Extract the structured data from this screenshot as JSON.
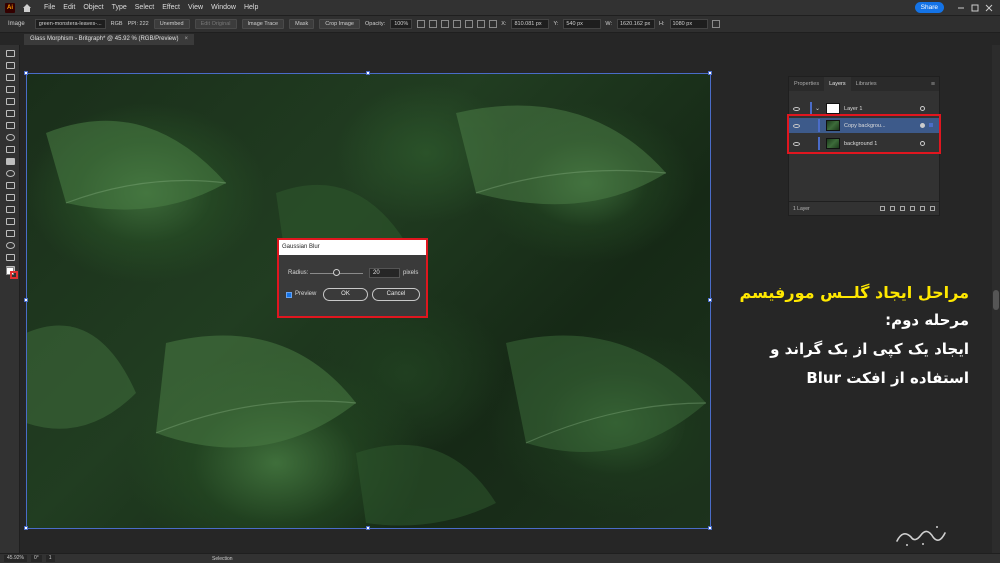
{
  "app": {
    "logo": "Ai",
    "menu": [
      "File",
      "Edit",
      "Object",
      "Type",
      "Select",
      "Effect",
      "View",
      "Window",
      "Help"
    ],
    "share_label": "Share"
  },
  "control_bar": {
    "selection_label": "Image",
    "file_name": "green-monstera-leaves-...",
    "color_mode": "RGB",
    "ppi": "PPI: 222",
    "embed_label": "Unembed",
    "edit_original_label": "Edit Original",
    "image_trace_label": "Image Trace",
    "mask_label": "Mask",
    "crop_label": "Crop Image",
    "opacity_label": "Opacity:",
    "opacity_value": "100%",
    "x_label": "X:",
    "x_value": "810.081 px",
    "y_label": "Y:",
    "y_value": "540 px",
    "w_label": "W:",
    "w_value": "1620.162 px",
    "h_label": "H:",
    "h_value": "1080 px"
  },
  "document_tab": {
    "title": "Glass Morphism - Britgraph* @ 45.92 % (RGB/Preview)",
    "close": "×"
  },
  "dialog": {
    "title": "Gaussian Blur",
    "radius_label": "Radius:",
    "radius_value": "20",
    "radius_unit": "pixels",
    "radius_fraction": 0.5,
    "preview_label": "Preview",
    "preview_checked": true,
    "ok_label": "OK",
    "cancel_label": "Cancel"
  },
  "layers_panel": {
    "tabs": [
      "Properties",
      "Layers",
      "Libraries"
    ],
    "active_tab": "Layers",
    "layers": [
      {
        "name": "Layer 1",
        "type": "group"
      },
      {
        "name": "Copy backgrou...",
        "type": "image",
        "selected": true
      },
      {
        "name": "background 1",
        "type": "image"
      }
    ],
    "footer_count": "1 Layer"
  },
  "overlay_text": {
    "title": "مراحل ایجاد گلــس مورفیسم",
    "lines": [
      "مرحله دوم:",
      "ایجاد یک کپی از بک گراند و",
      "استفاده از افکت Blur"
    ]
  },
  "status_bar": {
    "zoom": "45.92%",
    "rotation": "0°",
    "artboard": "1",
    "mode": "Selection"
  },
  "colors": {
    "accent_blue": "#1473e6",
    "highlight_red": "#e0161f",
    "title_yellow": "#ffe800"
  }
}
